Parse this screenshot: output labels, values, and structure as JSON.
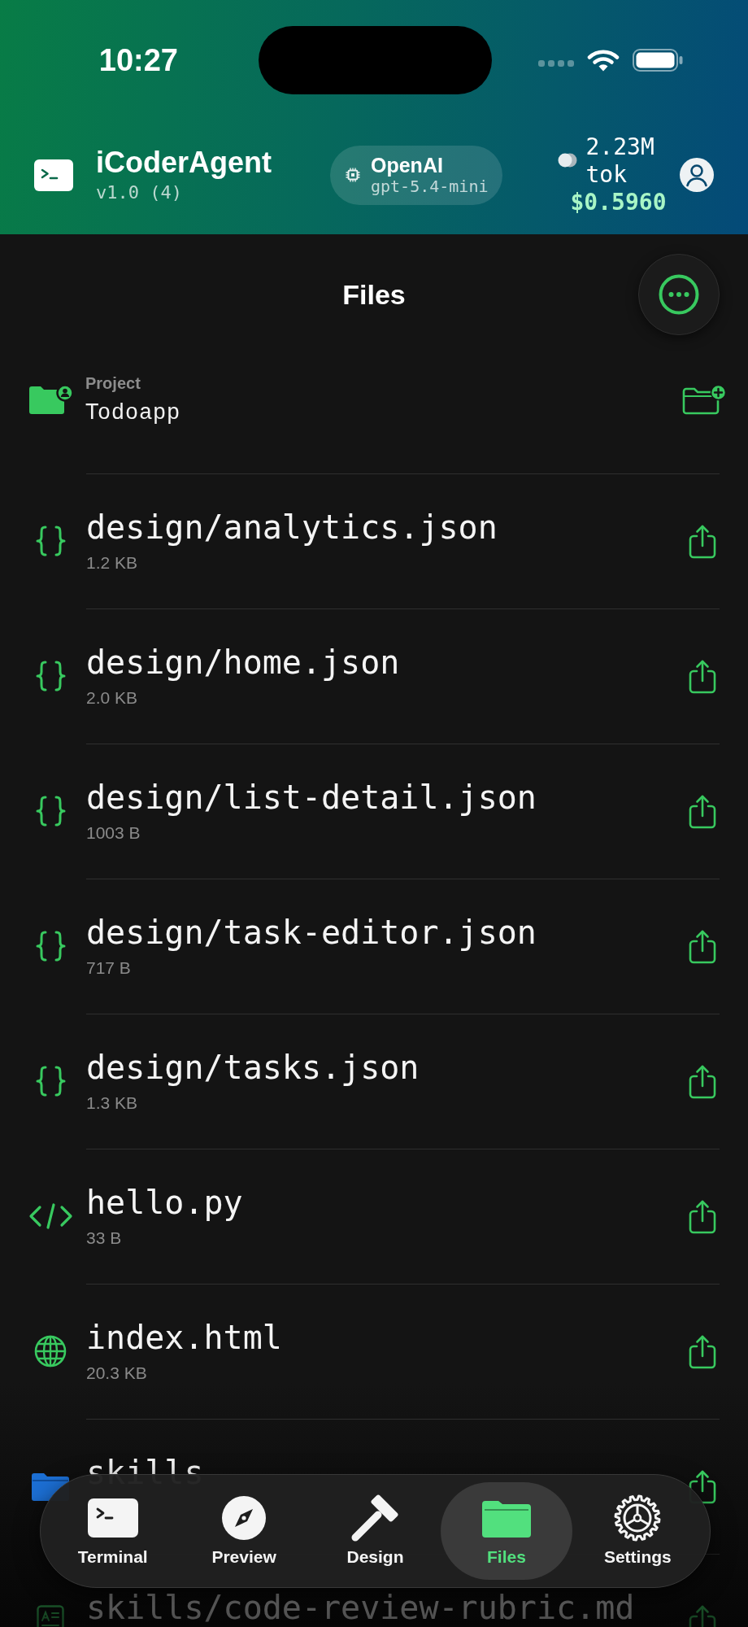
{
  "status_bar": {
    "time": "10:27"
  },
  "header": {
    "app_name": "iCoderAgent",
    "version": "v1.0 (4)",
    "model": {
      "provider": "OpenAI",
      "name": "gpt-5.4-mini"
    },
    "usage": {
      "tokens": "2.23M tok",
      "cost": "$0.5960"
    }
  },
  "files_view": {
    "title": "Files",
    "project": {
      "label": "Project",
      "name": "Todoapp"
    },
    "files": [
      {
        "kind": "json",
        "name": "design/analytics.json",
        "size": "1.2 KB"
      },
      {
        "kind": "json",
        "name": "design/home.json",
        "size": "2.0 KB"
      },
      {
        "kind": "json",
        "name": "design/list-detail.json",
        "size": "1003 B"
      },
      {
        "kind": "json",
        "name": "design/task-editor.json",
        "size": "717 B"
      },
      {
        "kind": "json",
        "name": "design/tasks.json",
        "size": "1.3 KB"
      },
      {
        "kind": "code",
        "name": "hello.py",
        "size": "33 B"
      },
      {
        "kind": "web",
        "name": "index.html",
        "size": "20.3 KB"
      },
      {
        "kind": "folder",
        "name": "skills"
      },
      {
        "kind": "doc",
        "name": "skills/code-review-rubric.md"
      }
    ]
  },
  "tab_bar": [
    {
      "label": "Terminal",
      "selected": false
    },
    {
      "label": "Preview",
      "selected": false
    },
    {
      "label": "Design",
      "selected": false
    },
    {
      "label": "Files",
      "selected": true
    },
    {
      "label": "Settings",
      "selected": false
    }
  ]
}
